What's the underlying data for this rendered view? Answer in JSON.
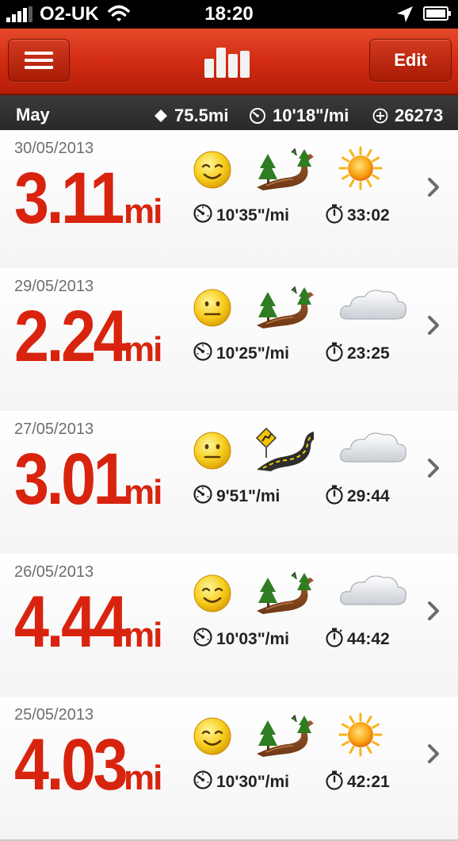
{
  "status_bar": {
    "carrier": "O2-UK",
    "time": "18:20"
  },
  "nav": {
    "edit_label": "Edit"
  },
  "summary": {
    "month": "May",
    "distance": "75.5mi",
    "pace": "10'18\"/mi",
    "calories": "26273"
  },
  "runs": [
    {
      "date": "30/05/2013",
      "distance": "3.11",
      "unit": "mi",
      "pace": "10'35\"/mi",
      "time": "33:02",
      "mood": "smile-icon",
      "terrain": "trail-icon",
      "weather": "sun-icon"
    },
    {
      "date": "29/05/2013",
      "distance": "2.24",
      "unit": "mi",
      "pace": "10'25\"/mi",
      "time": "23:25",
      "mood": "neutral-face-icon",
      "terrain": "trail-icon",
      "weather": "cloud-icon"
    },
    {
      "date": "27/05/2013",
      "distance": "3.01",
      "unit": "mi",
      "pace": "9'51\"/mi",
      "time": "29:44",
      "mood": "neutral-face-icon",
      "terrain": "road-icon",
      "weather": "cloud-icon"
    },
    {
      "date": "26/05/2013",
      "distance": "4.44",
      "unit": "mi",
      "pace": "10'03\"/mi",
      "time": "44:42",
      "mood": "smile-icon",
      "terrain": "trail-icon",
      "weather": "cloud-icon"
    },
    {
      "date": "25/05/2013",
      "distance": "4.03",
      "unit": "mi",
      "pace": "10'30\"/mi",
      "time": "42:21",
      "mood": "smile-icon",
      "terrain": "trail-icon",
      "weather": "sun-icon"
    }
  ],
  "colors": {
    "accent": "#d8240e",
    "nav_top": "#e54a2a",
    "nav_bottom": "#b51d07",
    "summary_bg": "#2e2e2e"
  }
}
